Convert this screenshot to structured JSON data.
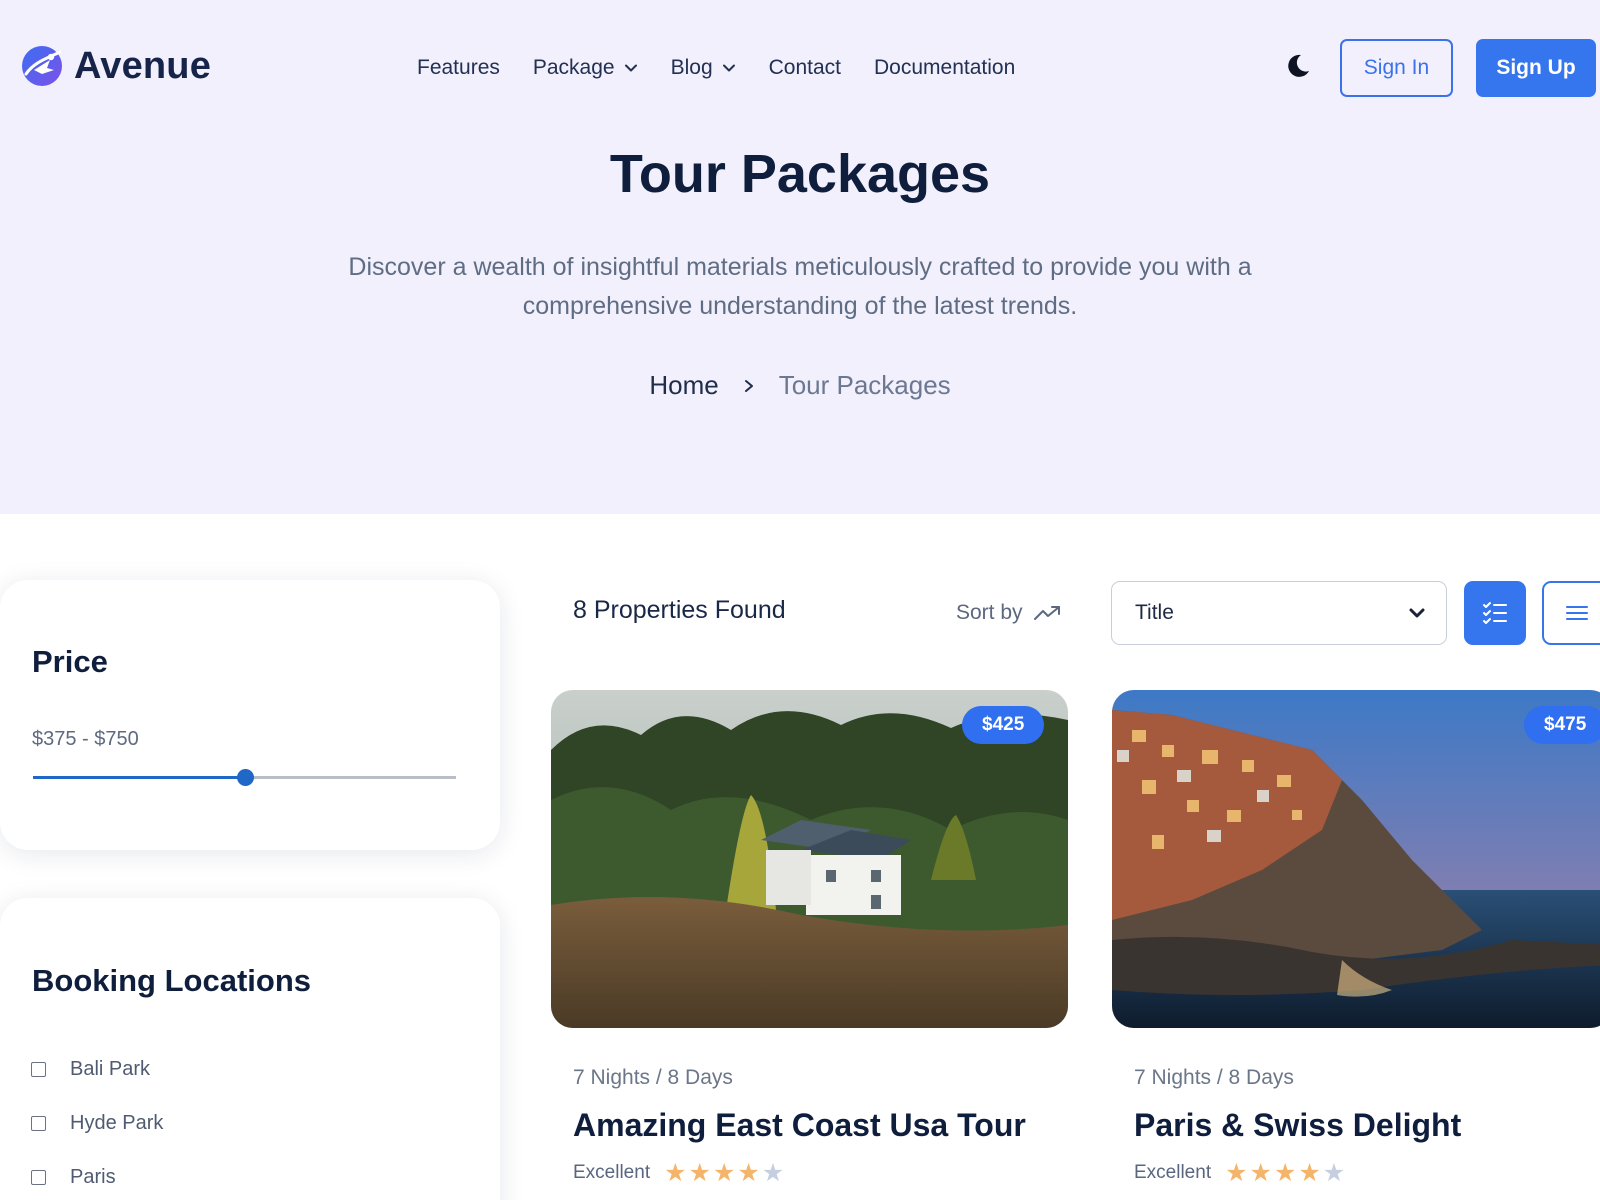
{
  "brand": {
    "name": "Avenue"
  },
  "nav": {
    "features": "Features",
    "package": "Package",
    "blog": "Blog",
    "contact": "Contact",
    "documentation": "Documentation"
  },
  "auth": {
    "sign_in": "Sign In",
    "sign_up": "Sign Up"
  },
  "hero": {
    "title": "Tour Packages",
    "description": "Discover a wealth of insightful materials meticulously crafted to provide you with a comprehensive understanding of the latest trends.",
    "breadcrumb": {
      "home": "Home",
      "current": "Tour Packages"
    }
  },
  "filters": {
    "price": {
      "title": "Price",
      "range_label": "$375 - $750",
      "slider_value_fraction": 0.5
    },
    "locations": {
      "title": "Booking Locations",
      "items": [
        {
          "label": "Bali Park",
          "checked": false
        },
        {
          "label": "Hyde Park",
          "checked": false
        },
        {
          "label": "Paris",
          "checked": false
        }
      ]
    }
  },
  "results": {
    "found_label": "8 Properties Found",
    "sort_by_label": "Sort by",
    "sort_select": {
      "value": "Title"
    }
  },
  "cards": [
    {
      "price": "$425",
      "duration": "7 Nights / 8 Days",
      "title": "Amazing East Coast Usa Tour",
      "rating_label": "Excellent",
      "rating": 4,
      "max_rating": 5
    },
    {
      "price": "$475",
      "duration": "7 Nights / 8 Days",
      "title": "Paris & Swiss Delight",
      "rating_label": "Excellent",
      "rating": 4,
      "max_rating": 5
    }
  ],
  "colors": {
    "accent": "#3575ee",
    "hero_bg": "#f2f0fc",
    "heading": "#0f1e3c",
    "star_filled": "#f4b56a",
    "star_empty": "#c5cfe0"
  },
  "icons": {
    "logo": "airplane-globe-icon",
    "theme_toggle": "moon-icon",
    "sort": "trend-up-icon",
    "list_view": "checklist-icon",
    "grid_view": "menu-lines-icon"
  }
}
